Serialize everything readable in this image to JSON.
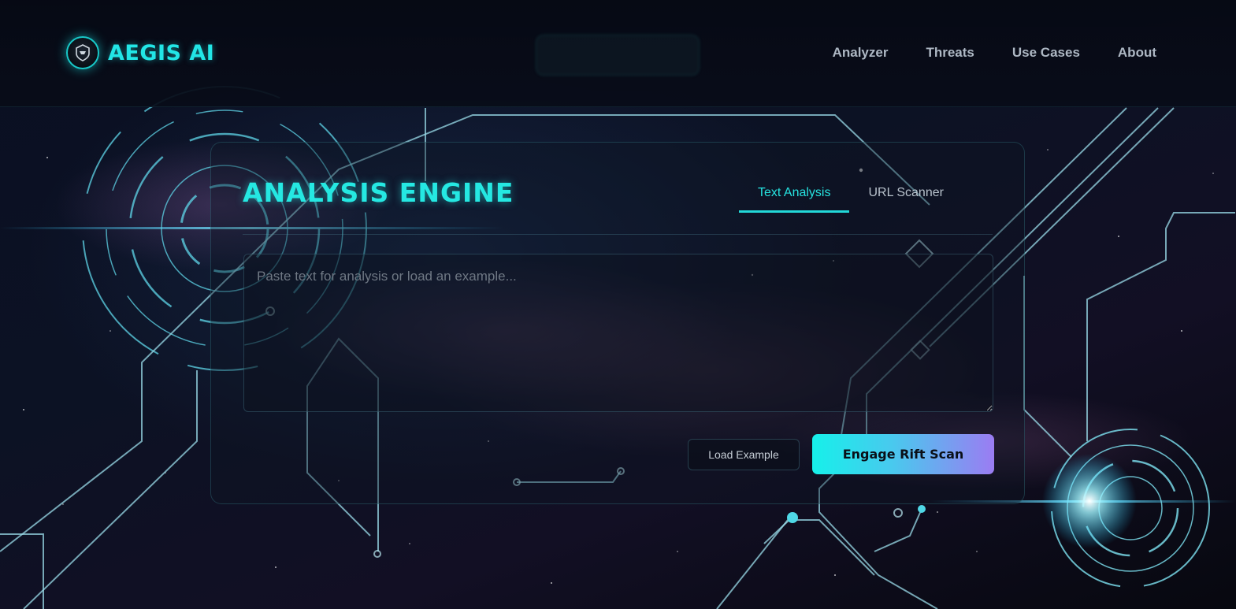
{
  "brand": {
    "name": "AEGIS AI",
    "logo_caption": "AEGIS AI",
    "logo_icon": "shield-helmet-icon"
  },
  "nav": {
    "items": [
      {
        "label": "Analyzer"
      },
      {
        "label": "Threats"
      },
      {
        "label": "Use Cases"
      },
      {
        "label": "About"
      }
    ]
  },
  "panel": {
    "title": "ANALYSIS ENGINE",
    "tabs": [
      {
        "label": "Text Analysis",
        "active": true
      },
      {
        "label": "URL Scanner",
        "active": false
      }
    ],
    "input": {
      "placeholder": "Paste text for analysis or load an example...",
      "value": ""
    },
    "load_example_label": "Load Example",
    "scan_label": "Engage Rift Scan"
  },
  "colors": {
    "accent": "#22e6e6",
    "gradient_start": "#16f0ea",
    "gradient_end": "#9b7cf2",
    "background": "#05070f"
  }
}
